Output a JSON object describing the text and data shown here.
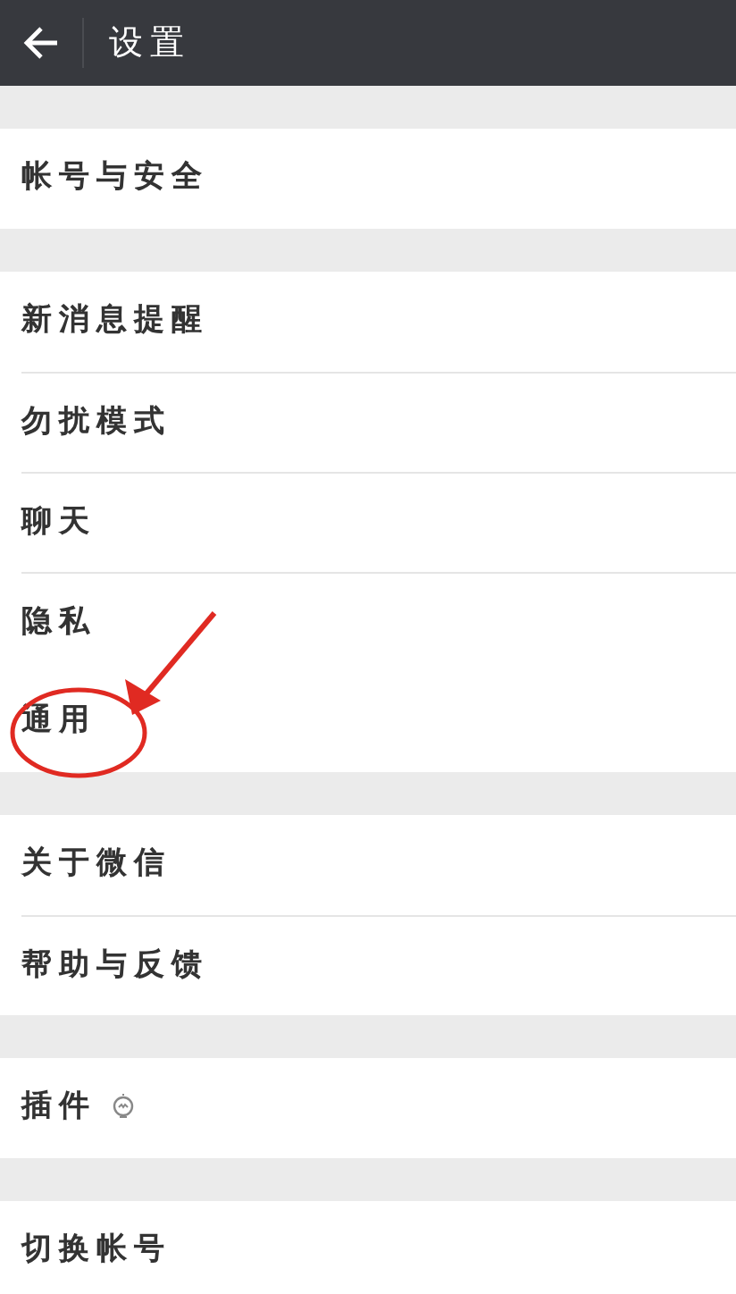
{
  "header": {
    "title": "设置"
  },
  "groups": [
    {
      "items": [
        {
          "label": "帐号与安全",
          "kind": "plain",
          "circled": false
        }
      ]
    },
    {
      "items": [
        {
          "label": "新消息提醒",
          "kind": "plain",
          "circled": false
        },
        {
          "label": "勿扰模式",
          "kind": "plain",
          "circled": false
        },
        {
          "label": "聊天",
          "kind": "plain",
          "circled": false
        },
        {
          "label": "隐私",
          "kind": "plain",
          "circled": false
        },
        {
          "label": "通用",
          "kind": "plain",
          "circled": true
        }
      ]
    },
    {
      "items": [
        {
          "label": "关于微信",
          "kind": "plain",
          "circled": false
        },
        {
          "label": "帮助与反馈",
          "kind": "plain",
          "circled": false
        }
      ]
    },
    {
      "items": [
        {
          "label": "插件",
          "kind": "with-icon",
          "circled": false
        }
      ]
    },
    {
      "items": [
        {
          "label": "切换帐号",
          "kind": "plain",
          "circled": false
        }
      ]
    }
  ]
}
